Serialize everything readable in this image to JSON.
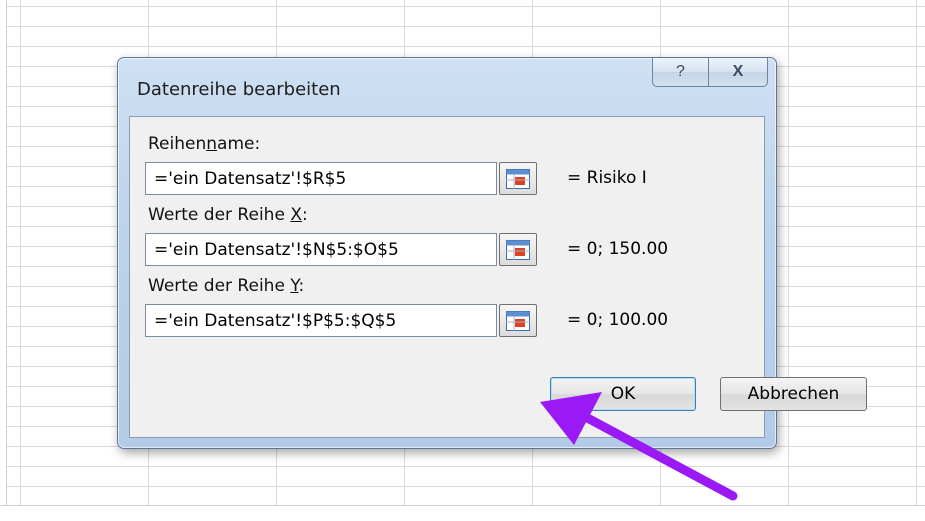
{
  "dialog": {
    "title": "Datenreihe bearbeiten",
    "help_glyph": "?",
    "close_glyph": "X"
  },
  "series_name": {
    "label_pre": "Reihen",
    "label_accel": "n",
    "label_post": "ame:",
    "value": "='ein Datensatz'!$R$5",
    "result": "= Risiko I"
  },
  "x_values": {
    "label_pre": "Werte der Reihe ",
    "label_accel": "X",
    "label_post": ":",
    "value": "='ein Datensatz'!$N$5:$O$5",
    "result": "= 0; 150.00"
  },
  "y_values": {
    "label_pre": "Werte der Reihe ",
    "label_accel": "Y",
    "label_post": ":",
    "value": "='ein Datensatz'!$P$5:$Q$5",
    "result": "= 0; 100.00"
  },
  "buttons": {
    "ok": "OK",
    "cancel": "Abbrechen"
  },
  "colors": {
    "annotation_arrow": "#9b19f5"
  }
}
